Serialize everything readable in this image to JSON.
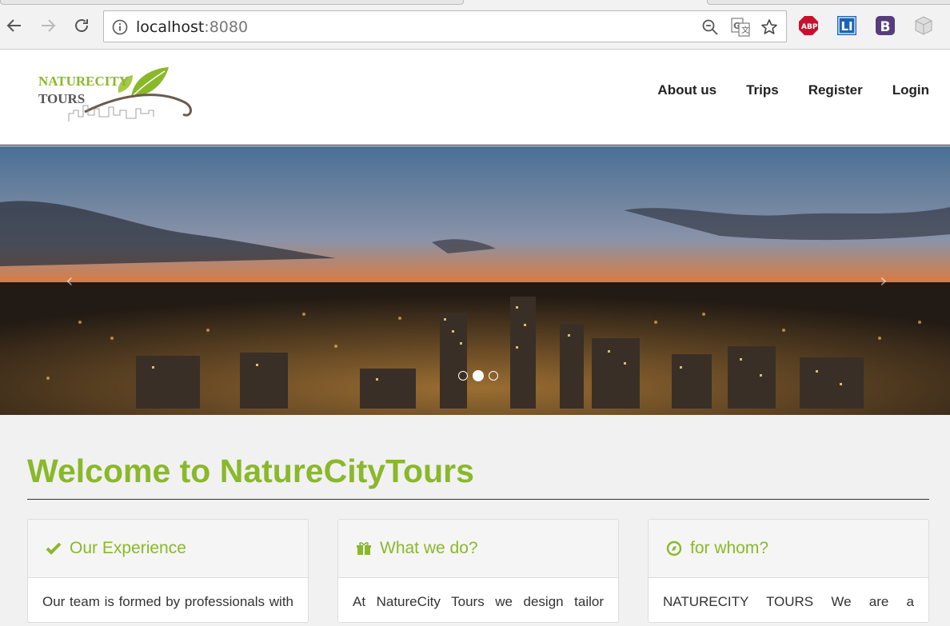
{
  "browser": {
    "url_host": "localhost",
    "url_port": ":8080"
  },
  "site": {
    "logo": {
      "line1": "NATURECITY",
      "line2": "TOURS"
    },
    "nav": [
      {
        "label": "About us"
      },
      {
        "label": "Trips"
      },
      {
        "label": "Register"
      },
      {
        "label": "Login"
      }
    ]
  },
  "carousel": {
    "prev": "‹",
    "next": "›",
    "slides": 3,
    "active_slide": 2
  },
  "main": {
    "heading": "Welcome to NatureCityTours",
    "panels": [
      {
        "icon": "checkmark-icon",
        "title": "Our Experience",
        "body": "Our team is formed by professionals with"
      },
      {
        "icon": "gift-icon",
        "title": "What we do?",
        "body": "At NatureCity Tours we design tailor"
      },
      {
        "icon": "compass-icon",
        "title": "for whom?",
        "body": "NATURECITY TOURS We are a"
      }
    ]
  },
  "colors": {
    "accent": "#8ab82a",
    "abp": "#c8102e",
    "lastpass_blue": "#1b64b4",
    "bootstrap_purple": "#563d7c"
  }
}
